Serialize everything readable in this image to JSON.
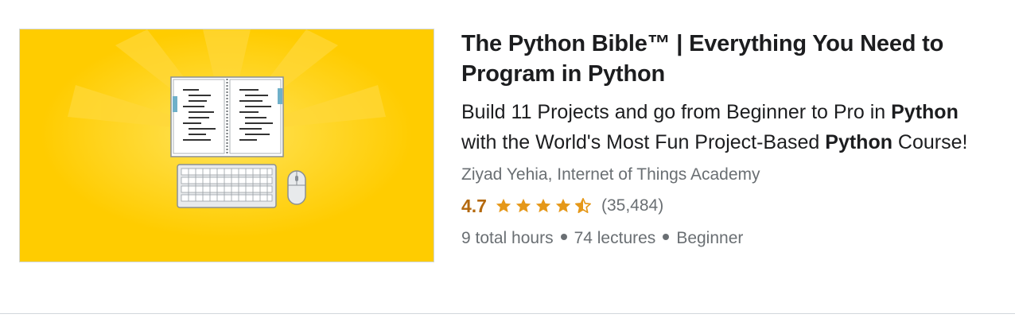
{
  "course": {
    "title": "The Python Bible™ | Everything You Need to Program in Python",
    "headline": {
      "part1": "Build 11 Projects and go from Beginner to Pro in ",
      "bold1": "Python",
      "part2": " with the World's Most Fun Project-Based ",
      "bold2": "Python",
      "part3": " Course!"
    },
    "instructors": "Ziyad Yehia, Internet of Things Academy",
    "rating": {
      "value": "4.7",
      "stars": 4.7,
      "count": "(35,484)"
    },
    "meta": {
      "hours": "9 total hours",
      "lectures": "74 lectures",
      "level": "Beginner"
    },
    "thumbnail": {
      "icons": [
        "open-book-icon",
        "keyboard-icon",
        "mouse-icon"
      ]
    }
  },
  "colors": {
    "thumbnail_bg": "#ffcc00",
    "rating_accent": "#b4690e",
    "star": "#e59819",
    "muted_text": "#6a6f73",
    "divider": "#d1d7dc"
  }
}
